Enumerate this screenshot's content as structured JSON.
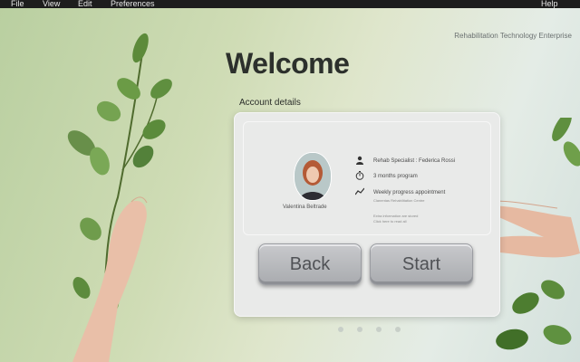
{
  "menu": {
    "items": [
      "File",
      "View",
      "Edit",
      "Preferences"
    ],
    "help": "Help"
  },
  "brand": "Rehabilitation Technology Enterprise",
  "welcome": "Welcome",
  "account_title": "Account details",
  "patient": {
    "name": "Valentina Beltrade"
  },
  "info": {
    "specialist": "Rehab Specialist :  Federica Rossi",
    "program": "3 months program",
    "appointment": "Weekly progress appointment",
    "appointment_sub": "Clanentas Rehabilitation Centre",
    "footnote1": "Extra information are stored",
    "footnote2": "Click here to read all"
  },
  "buttons": {
    "back": "Back",
    "start": "Start"
  },
  "pager": {
    "count": 4,
    "active": 0
  },
  "icons": {
    "specialist": "person-icon",
    "program": "timer-icon",
    "appointment": "trend-icon"
  }
}
